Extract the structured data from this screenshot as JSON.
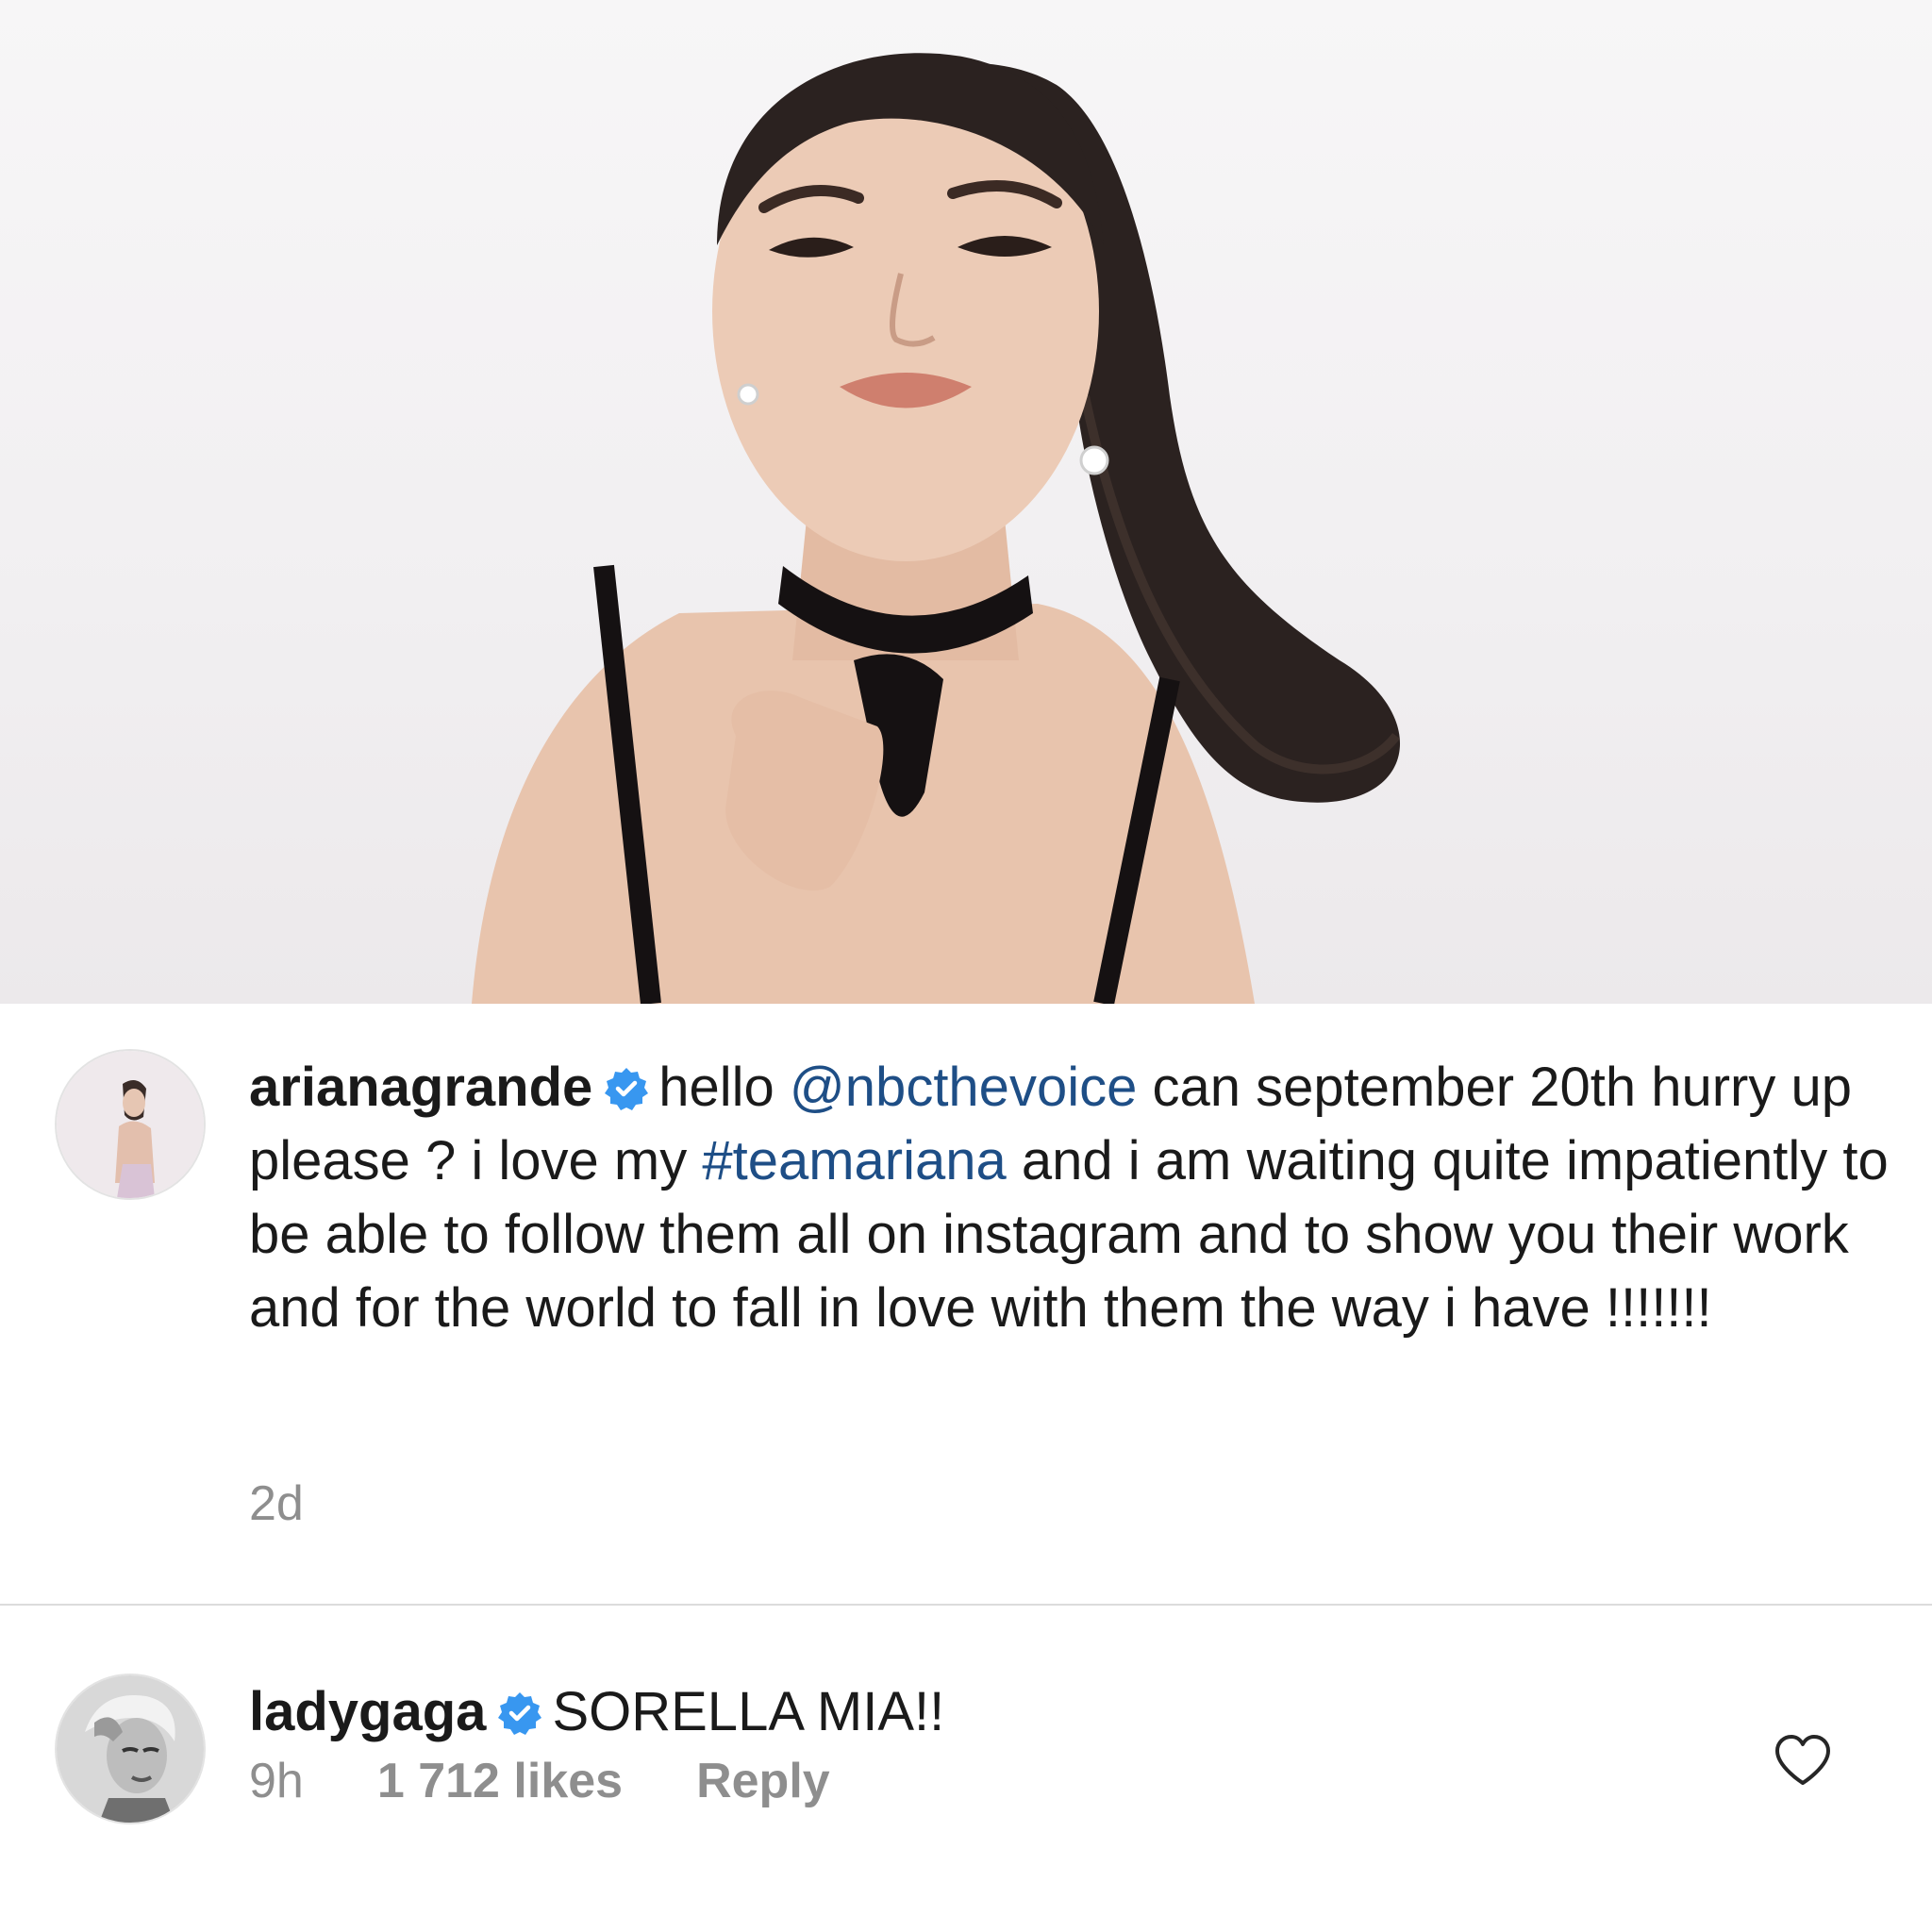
{
  "post_image": {
    "alt": "portrait photo"
  },
  "comments": [
    {
      "username": "arianagrande",
      "verified": true,
      "text_parts": {
        "p1": "hello ",
        "mention": "@nbcthevoice",
        "p2": " can september 20th hurry up please ? i love my ",
        "hashtag": "#teamariana",
        "p3": " and i am waiting quite impatiently to be able to follow them all on instagram and to show you their work and for the world to fall in love with them the way i have !!!!!!!"
      },
      "time": "2d"
    },
    {
      "username": "ladygaga",
      "verified": true,
      "text": "SORELLA MIA!!",
      "time": "9h",
      "likes": "1 712 likes",
      "reply_label": "Reply"
    }
  ],
  "icons": {
    "verified": "verified-badge-icon",
    "like": "heart-outline-icon"
  },
  "colors": {
    "link": "#1e4e86",
    "verified": "#3897f0",
    "meta": "#8e8e8e"
  }
}
